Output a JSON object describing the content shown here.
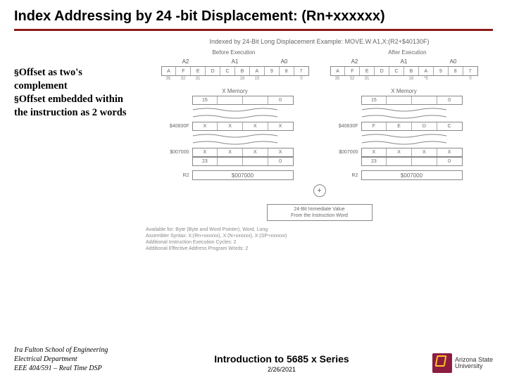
{
  "title": "Index Addressing by 24 -bit Displacement: (Rn+xxxxxx)",
  "bullets": {
    "b1": "Offset as two's complement",
    "b2": "Offset embedded within the instruction as 2 words"
  },
  "diagram": {
    "caption": "Indexed by 24-Bit Long Displacement Example: MOVE.W A1,X:(R2+$40130F)",
    "before": "Before Execution",
    "after": "After Execution",
    "regA2": "A2",
    "regA1": "A1",
    "regA0": "A0",
    "xmem": "X Memory",
    "r2": "R2",
    "r2val_before": "$007000",
    "r2val_after": "$007000",
    "addr1": "$40830F",
    "addr2": "$007000",
    "addr1b": "$40830F",
    "addr2b": "$007000",
    "imm_line1": "24-Bit Immediate Value",
    "imm_line2": "From the Instruction Word",
    "avail1": "Available for: Byte (Byte and Word Pointer), Word, Long",
    "avail2": "Assembler Syntax: X:(Rn+xxxxxx), X:(N+xxxxxx), X:(SP+xxxxxx)",
    "avail3": "Additional Instruction Execution Cycles: 2",
    "avail4": "Additional Effective Address Program Words: 2",
    "n15": "15",
    "n23": "23",
    "n0": "0",
    "b35": "35",
    "b32": "32",
    "b31": "31",
    "b16": "16",
    "b15p": "15",
    "b0p": "0"
  },
  "footer": {
    "l1": "Ira Fulton School of Engineering",
    "l2": "Electrical Department",
    "l3": "EEE 404/591 – Real Time DSP",
    "center": "Introduction to 5685 x Series",
    "date": "2/26/2021",
    "logo1": "Arizona State",
    "logo2": "University"
  }
}
